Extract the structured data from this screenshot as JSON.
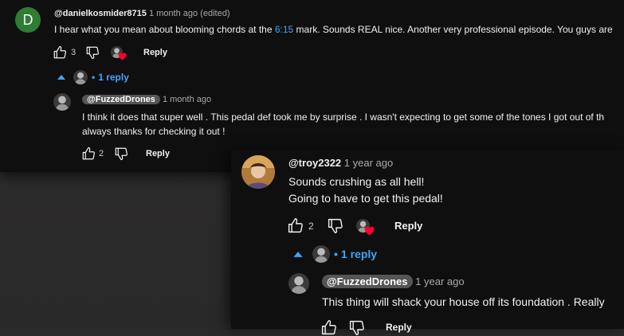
{
  "comment1": {
    "avatar_letter": "D",
    "author": "@danielkosmider8715",
    "time": "1 month ago (edited)",
    "text_before": "I hear what you mean about blooming chords at the ",
    "timestamp_link": "6:15",
    "text_after": " mark. Sounds REAL nice. Another very professional episode. You guys are",
    "likes": "3",
    "reply_label": "Reply",
    "replies_toggle": "1 reply"
  },
  "reply1": {
    "author": "@FuzzedDrones",
    "time": "1 month ago",
    "line1": "I think it does that super well . This pedal def took me by surprise . I wasn't expecting to get some of the tones I got out of th",
    "line2": "always thanks for checking it out !",
    "likes": "2",
    "reply_label": "Reply"
  },
  "comment2": {
    "author": "@troy2322",
    "time": "1 year ago",
    "line1": "Sounds crushing as all hell!",
    "line2": "Going to have to get this pedal!",
    "likes": "2",
    "reply_label": "Reply",
    "replies_toggle": "1 reply"
  },
  "reply2": {
    "author": "@FuzzedDrones",
    "time": "1 year ago",
    "line1": "This thing will shack your house off its foundation . Really",
    "reply_label": "Reply"
  },
  "colors": {
    "link": "#3ea6ff",
    "heart": "#ff0033",
    "avatar_green": "#2e7d32"
  }
}
